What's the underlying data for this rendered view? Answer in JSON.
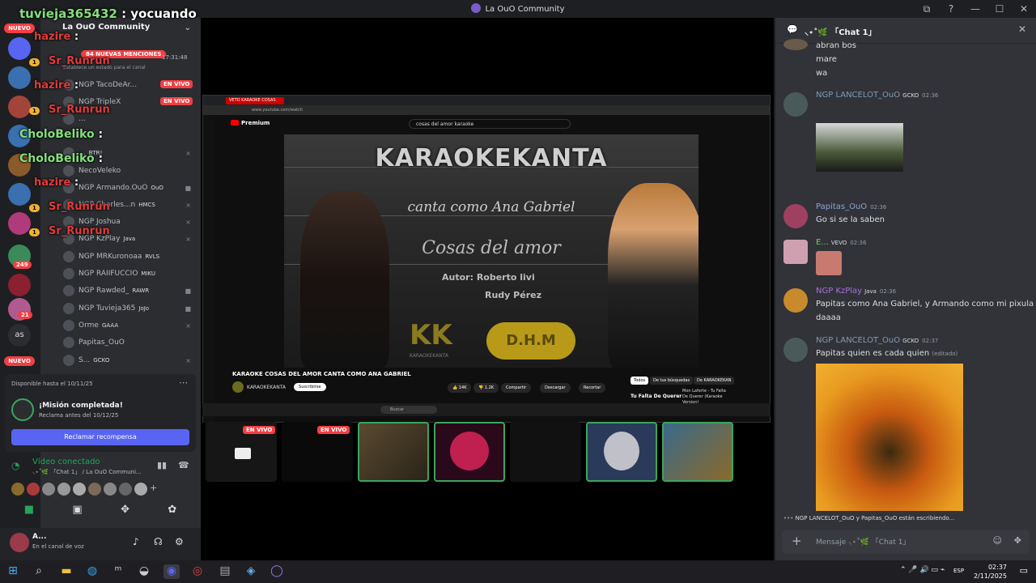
{
  "window": {
    "title": "La OuO Community",
    "controls": [
      "⧉",
      "?",
      "—",
      "☐",
      "✕"
    ]
  },
  "overlay_chat": [
    {
      "user": "tuvieja365432",
      "text": ": yocuando",
      "color": "green"
    },
    {
      "user": "hazire",
      "text": ":",
      "color": "red"
    },
    {
      "user": "Sr_Runrun",
      "text": "",
      "color": "red"
    },
    {
      "user": "hazire",
      "text": ":",
      "color": "red"
    },
    {
      "user": "Sr_Runrun",
      "text": "",
      "color": "red"
    },
    {
      "user": "CholoBeliko",
      "text": ":",
      "color": "green"
    },
    {
      "user": "CholoBeliko",
      "text": ":",
      "color": "green"
    },
    {
      "user": "hazire",
      "text": ":",
      "color": "red"
    },
    {
      "user": "Sr_Runrun",
      "text": "",
      "color": "red"
    },
    {
      "user": "Sr_Runrun",
      "text": "",
      "color": "red"
    }
  ],
  "servers": {
    "badges": [
      "NUEVO",
      "249",
      "21",
      "as",
      "NUEVO"
    ],
    "unread_counts": [
      "1",
      "1",
      "1",
      "1"
    ]
  },
  "channels": {
    "server_name": "La OuO Community",
    "mentions_pill": "84 NUEVAS MENCIONES",
    "status_time": "17:31:48",
    "status_hint": "Establece un estado para el canal",
    "live_label": "EN VIVO",
    "members": [
      {
        "name": "NGP TacoDeAr...",
        "tag": "",
        "live": true
      },
      {
        "name": "NGP TripleX",
        "tag": "",
        "live": true
      },
      {
        "name": "...",
        "tag": ""
      },
      {
        "name": "...",
        "tag": "BTR!"
      },
      {
        "name": "NecoVeleko",
        "tag": ""
      },
      {
        "name": "NGP Armando.OuO",
        "tag": "OuO"
      },
      {
        "name": "NGP Charles...n",
        "tag": "HMCS"
      },
      {
        "name": "NGP Joshua",
        "tag": ""
      },
      {
        "name": "NGP KzPlay",
        "tag": "Java"
      },
      {
        "name": "NGP MRKuronoaa",
        "tag": "RVLS"
      },
      {
        "name": "NGP RAIIFUCCIO",
        "tag": "MIKU"
      },
      {
        "name": "NGP Rawded_",
        "tag": "RAWR"
      },
      {
        "name": "NGP Tuvieja365",
        "tag": "JoJo"
      },
      {
        "name": "Orme",
        "tag": "GAAA"
      },
      {
        "name": "Papitas_OuO",
        "tag": ""
      },
      {
        "name": "S...",
        "tag": "GCKO"
      }
    ]
  },
  "mission": {
    "available": "Disponible hasta el 10/11/25",
    "title": "¡Misión completada!",
    "sub": "Reclama antes del 10/12/25",
    "button": "Reclamar recompensa"
  },
  "voice": {
    "status": "Vídeo conectado",
    "channel": "⸜⋆˚🌿 「Chat 1」 / La OuO Communi..."
  },
  "user": {
    "name": "A...",
    "status": "En el canal de voz"
  },
  "youtube": {
    "tab": "VETO KARAOKE COSAS",
    "url": "www.youtube.com/watch",
    "brand": "Premium",
    "search": "cosas del amor karaoke",
    "video_title": "KARAOKE COSAS DEL AMOR CANTA COMO ANA GABRIEL",
    "channel": "KARAOKEKANTA",
    "subscribe": "Suscribirse",
    "likes": "14K",
    "dislikes": "1.2K",
    "share": "Compartir",
    "download": "Descargar",
    "clip": "Recortar",
    "chips": [
      "Todos",
      "De tus búsquedas",
      "De KARAOKEKAN"
    ],
    "next_video": "Tu Falta De Querer",
    "next_artist": "Mon Laferte - Tu Falta De Querer (Karaoke Version)",
    "search_box": "Buscar"
  },
  "video_text": {
    "brand": "KARAOKEKANTA",
    "sub": "canta como Ana Gabriel",
    "song": "Cosas del amor",
    "author1": "Autor: Roberto livi",
    "author2": "Rudy Pérez",
    "kk": "KK",
    "kk_label": "KARAOKEKANTA",
    "dhm": "D.H.M"
  },
  "streams": {
    "live": "EN VIVO"
  },
  "chat": {
    "title": "⸜⋆˚🌿 「Chat 1」",
    "messages": [
      {
        "name": "",
        "lines": [
          "abran bos",
          "mare",
          "wa"
        ],
        "color": "#dbdee1"
      },
      {
        "name": "NGP LANCELOT_OuO",
        "tag": "GCKO",
        "time": "02:36",
        "lines": [],
        "color": "#7e9bb5"
      },
      {
        "name": "Papitas_OuO",
        "time": "02:36",
        "lines": [
          "Go si se la saben"
        ],
        "color": "#8fa3d9"
      },
      {
        "name": "E...",
        "tag": "VEVO",
        "time": "02:36",
        "lines": [],
        "color": "#79c95a"
      },
      {
        "name": "NGP KzPlay",
        "tag": "Java",
        "time": "02:36",
        "lines": [
          "Papitas como Ana Gabriel, y Armando como mi pixula",
          "daaaa"
        ],
        "color": "#a772d9"
      },
      {
        "name": "NGP LANCELOT_OuO",
        "tag": "GCKO",
        "time": "02:37",
        "lines": [
          "Papitas quien es cada quien"
        ],
        "edited": "(editado)",
        "color": "#7e9bb5"
      }
    ],
    "typing": "NGP LANCELOT_OuO y Papitas_OuO están escribiendo...",
    "placeholder": "Mensaje ⸜⋆˚🌿 「Chat 1」"
  },
  "taskbar": {
    "lang": "ESP",
    "time": "02:37",
    "date": "2/11/2025"
  }
}
